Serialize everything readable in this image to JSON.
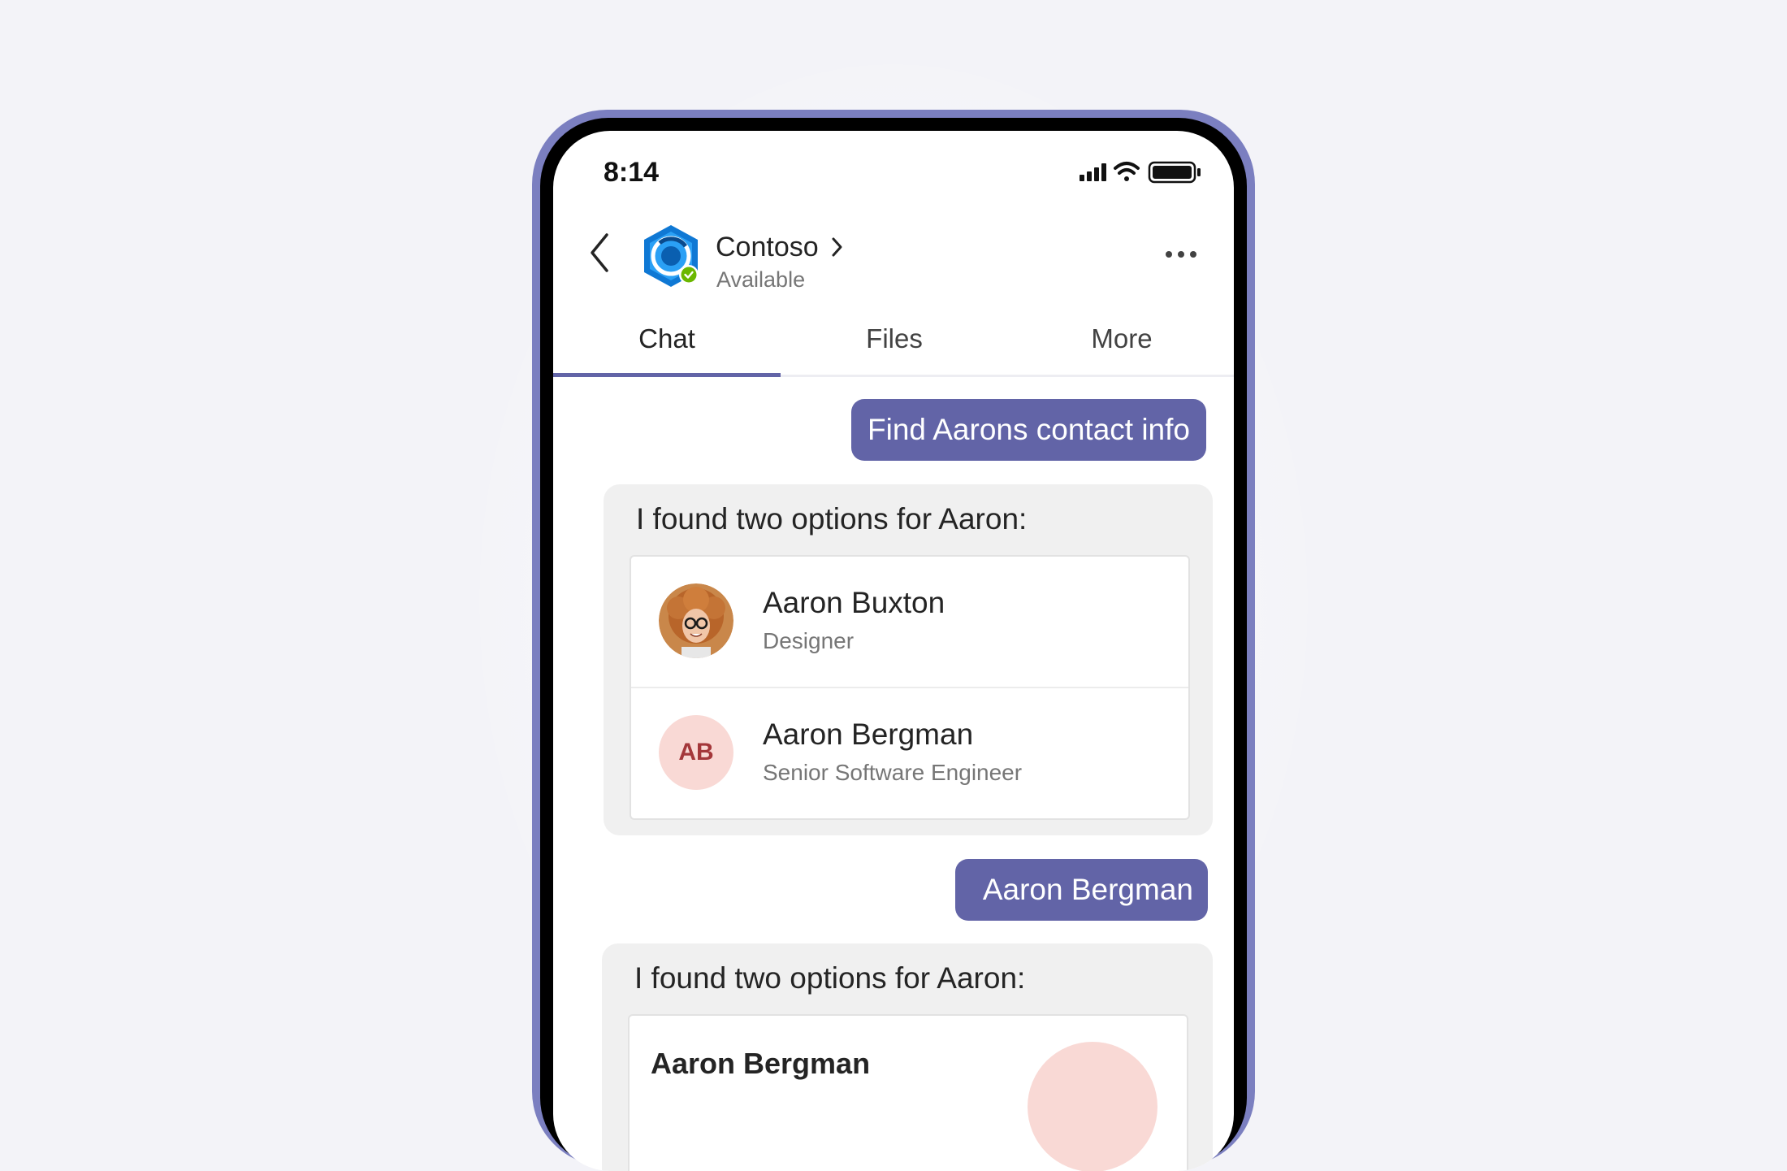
{
  "status_bar": {
    "time": "8:14"
  },
  "header": {
    "contact_name": "Contoso",
    "contact_status": "Available"
  },
  "tabs": [
    {
      "label": "Chat",
      "active": true
    },
    {
      "label": "Files",
      "active": false
    },
    {
      "label": "More",
      "active": false
    }
  ],
  "messages": {
    "user_1": "Find Aarons contact info",
    "bot_1": {
      "text": "I found two options for Aaron:",
      "people": [
        {
          "name": "Aaron Buxton",
          "role": "Designer"
        },
        {
          "name": "Aaron Bergman",
          "role": "Senior Software Engineer",
          "initials": "AB"
        }
      ]
    },
    "user_2": "Aaron Bergman",
    "bot_2": {
      "text": "I found two options for Aaron:",
      "card_name": "Aaron Bergman"
    }
  },
  "colors": {
    "accent": "#6264a7",
    "frame": "#7b7fc0",
    "available": "#6bb700",
    "initials_bg": "#f9d9d5",
    "initials_text": "#a4373a"
  }
}
